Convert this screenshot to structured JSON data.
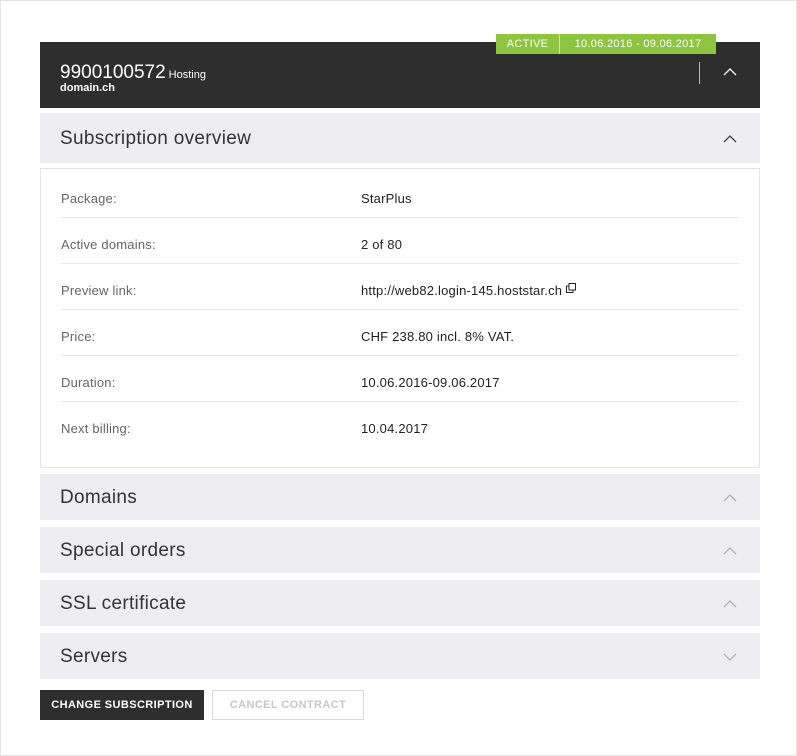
{
  "subscription": {
    "status": "ACTIVE",
    "period": "10.06.2016 - 09.06.2017",
    "id": "9900100572",
    "type": "Hosting",
    "domain": "domain.ch"
  },
  "overview": {
    "title": "Subscription overview",
    "rows": [
      {
        "label": "Package:",
        "value": "StarPlus"
      },
      {
        "label": "Active domains:",
        "value": "2 of 80"
      },
      {
        "label": "Preview link:",
        "value": "http://web82.login-145.hoststar.ch"
      },
      {
        "label": "Price:",
        "value": "CHF 238.80 incl. 8% VAT."
      },
      {
        "label": "Duration:",
        "value": "10.06.2016-09.06.2017"
      },
      {
        "label": "Next billing:",
        "value": "10.04.2017"
      }
    ]
  },
  "sections": {
    "domains": "Domains",
    "special_orders": "Special orders",
    "ssl": "SSL certificate",
    "servers": "Servers"
  },
  "actions": {
    "change": "CHANGE SUBSCRIPTION",
    "cancel": "CANCEL CONTRACT"
  },
  "colors": {
    "header_bg": "#2e2e2e",
    "accent_green": "#8cc63f",
    "section_bg": "#eeeef2"
  },
  "icons": {
    "collapse": "chevron-up-icon",
    "expand": "chevron-down-icon",
    "external": "external-link-icon"
  }
}
